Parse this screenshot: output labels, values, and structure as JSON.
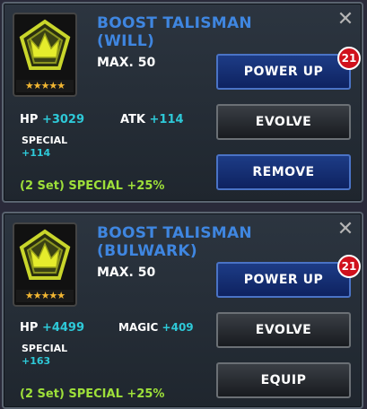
{
  "cards": [
    {
      "title_line1": "BOOST TALISMAN",
      "title_line2": "(WILL)",
      "max_level": "MAX. 50",
      "stars": "★★★★★",
      "stat1_label": "HP",
      "stat1_value": "+3029",
      "stat2_label": "ATK",
      "stat2_value": "+114",
      "special_label": "SPECIAL",
      "special_value": "+114",
      "set_bonus": "(2 Set) SPECIAL +25%",
      "buttons": [
        "POWER UP",
        "EVOLVE",
        "REMOVE"
      ],
      "badge_count": "21",
      "close_icon": "✕"
    },
    {
      "title_line1": "BOOST TALISMAN",
      "title_line2": "(BULWARK)",
      "max_level": "MAX. 50",
      "stars": "★★★★★",
      "stat1_label": "HP",
      "stat1_value": "+4499",
      "stat2_label": "MAGIC",
      "stat2_value": "+409",
      "special_label": "SPECIAL",
      "special_value": "+163",
      "set_bonus": "(2 Set) SPECIAL +25%",
      "buttons": [
        "POWER UP",
        "EVOLVE",
        "EQUIP"
      ],
      "badge_count": "21",
      "close_icon": "✕"
    }
  ],
  "colors": {
    "title": "#3f86e0",
    "stat_value": "#2ec9d8",
    "set_bonus": "#9ee03a",
    "badge": "#d0111c",
    "stars": "#f2b632"
  },
  "icons": {
    "talisman": "pentagon-crown-icon",
    "close": "close-icon",
    "star": "star-icon"
  }
}
